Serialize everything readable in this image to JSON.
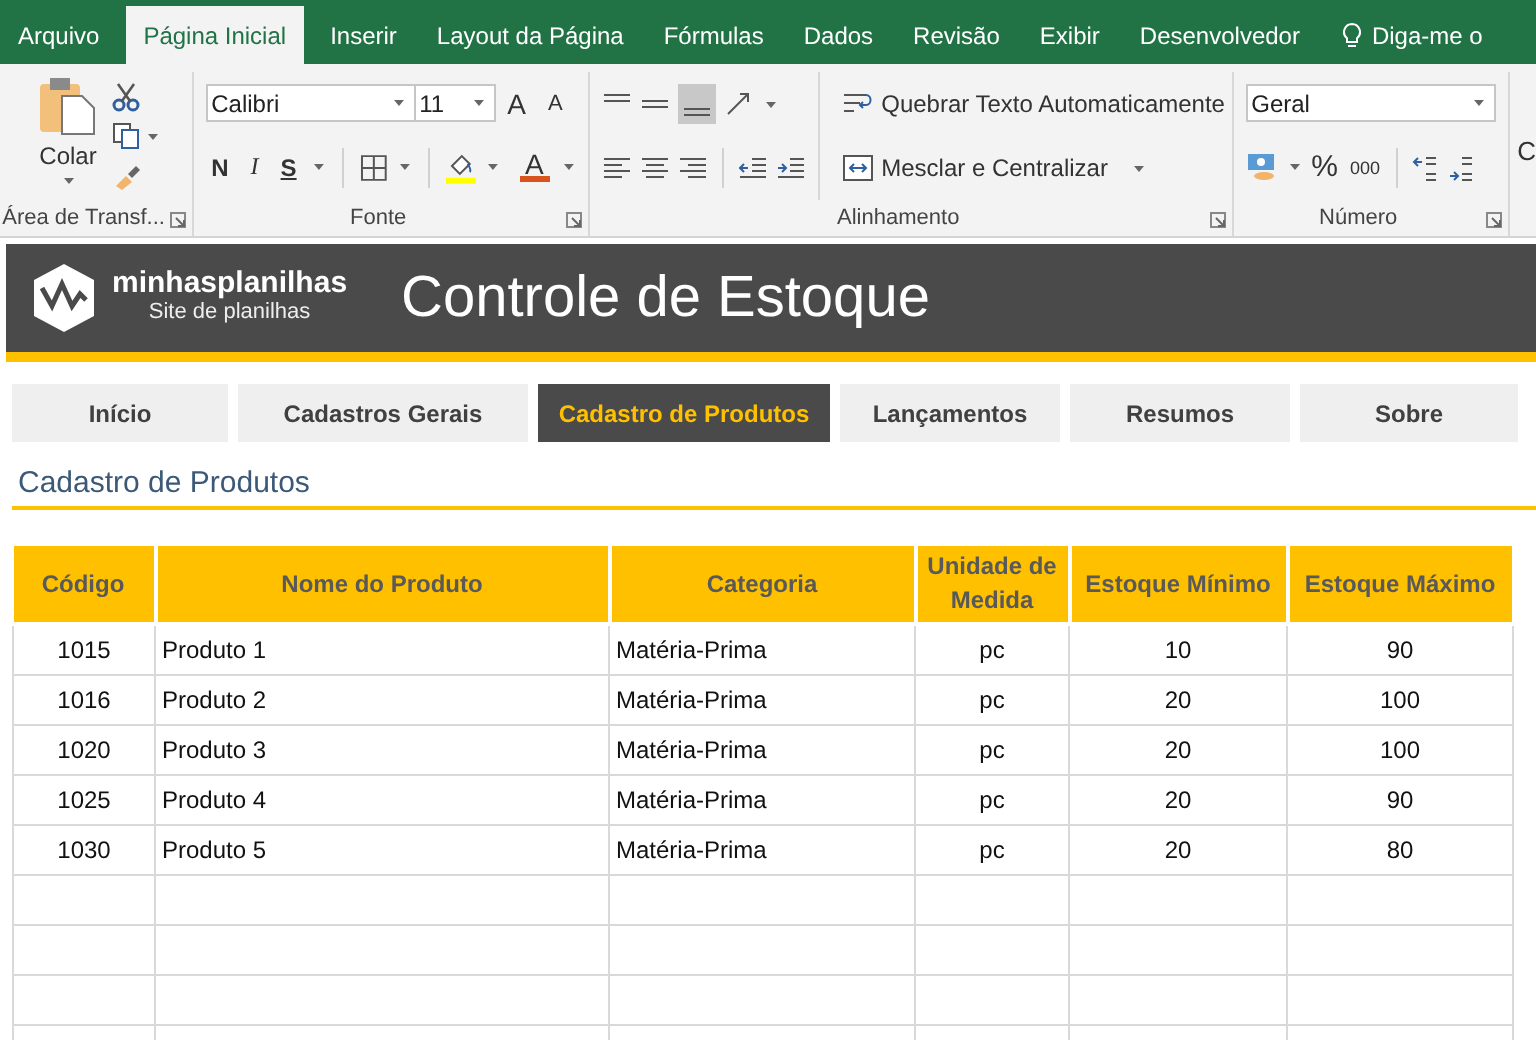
{
  "ribbon_tabs": [
    {
      "label": "Arquivo",
      "selected": false
    },
    {
      "label": "Página Inicial",
      "selected": true
    },
    {
      "label": "Inserir",
      "selected": false
    },
    {
      "label": "Layout da Página",
      "selected": false
    },
    {
      "label": "Fórmulas",
      "selected": false
    },
    {
      "label": "Dados",
      "selected": false
    },
    {
      "label": "Revisão",
      "selected": false
    },
    {
      "label": "Exibir",
      "selected": false
    },
    {
      "label": "Desenvolvedor",
      "selected": false
    }
  ],
  "tell_me": "Diga-me o",
  "clipboard": {
    "paste_label": "Colar",
    "group_label": "Área de Transf..."
  },
  "font": {
    "name": "Calibri",
    "size": "11",
    "grow_glyph": "A",
    "shrink_glyph": "A",
    "bold": "N",
    "italic": "I",
    "underline": "S",
    "color_glyph": "A",
    "group_label": "Fonte"
  },
  "alignment": {
    "wrap_text": "Quebrar Texto Automaticamente",
    "merge": "Mesclar e Centralizar",
    "group_label": "Alinhamento"
  },
  "number": {
    "format": "Geral",
    "percent": "%",
    "thousands": "000",
    "group_label": "Número"
  },
  "edge_text": "C",
  "header": {
    "logo_name": "minhasplanilhas",
    "logo_tagline": "Site de planilhas",
    "title": "Controle de Estoque"
  },
  "nav_tabs": [
    {
      "label": "Início",
      "selected": false
    },
    {
      "label": "Cadastros Gerais",
      "selected": false
    },
    {
      "label": "Cadastro de Produtos",
      "selected": true
    },
    {
      "label": "Lançamentos",
      "selected": false
    },
    {
      "label": "Resumos",
      "selected": false
    },
    {
      "label": "Sobre",
      "selected": false
    }
  ],
  "section_title": "Cadastro de Produtos",
  "table": {
    "columns": [
      "Código",
      "Nome do Produto",
      "Categoria",
      "Unidade de Medida",
      "Estoque Mínimo",
      "Estoque Máximo"
    ],
    "rows": [
      [
        "1015",
        "Produto 1",
        "Matéria-Prima",
        "pc",
        "10",
        "90"
      ],
      [
        "1016",
        "Produto 2",
        "Matéria-Prima",
        "pc",
        "20",
        "100"
      ],
      [
        "1020",
        "Produto 3",
        "Matéria-Prima",
        "pc",
        "20",
        "100"
      ],
      [
        "1025",
        "Produto 4",
        "Matéria-Prima",
        "pc",
        "20",
        "90"
      ],
      [
        "1030",
        "Produto 5",
        "Matéria-Prima",
        "pc",
        "20",
        "80"
      ]
    ]
  }
}
